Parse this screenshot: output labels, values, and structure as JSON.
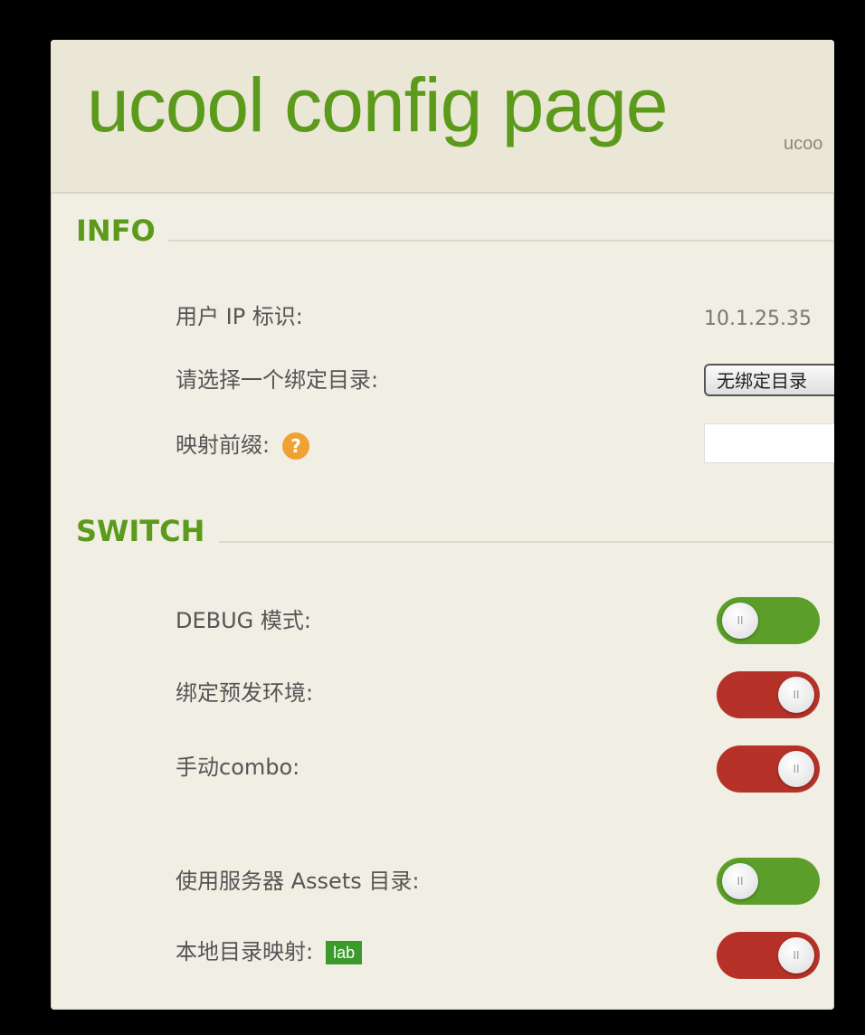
{
  "header": {
    "title": "ucool config page",
    "subtitle": "ucoo"
  },
  "info": {
    "section_title": "INFO",
    "user_ip_label": "用户 IP 标识:",
    "user_ip_value": "10.1.25.35",
    "bind_dir_label": "请选择一个绑定目录:",
    "bind_dir_selected": "无绑定目录",
    "mapping_prefix_label": "映射前缀:",
    "mapping_prefix_value": "",
    "help_icon_glyph": "?"
  },
  "switch": {
    "section_title": "SWITCH",
    "items": [
      {
        "label": "DEBUG 模式:",
        "state": "on"
      },
      {
        "label": "绑定预发环境:",
        "state": "off"
      },
      {
        "label": "手动combo:",
        "state": "off"
      },
      {
        "label": "使用服务器 Assets 目录:",
        "state": "on"
      },
      {
        "label": "本地目录映射:",
        "state": "off",
        "badge": "lab"
      }
    ],
    "knob_glyph": "II"
  },
  "colors": {
    "accent": "#5b9a1a",
    "toggle_on": "#5b9f2a",
    "toggle_off": "#b63229",
    "help": "#f0a133"
  }
}
